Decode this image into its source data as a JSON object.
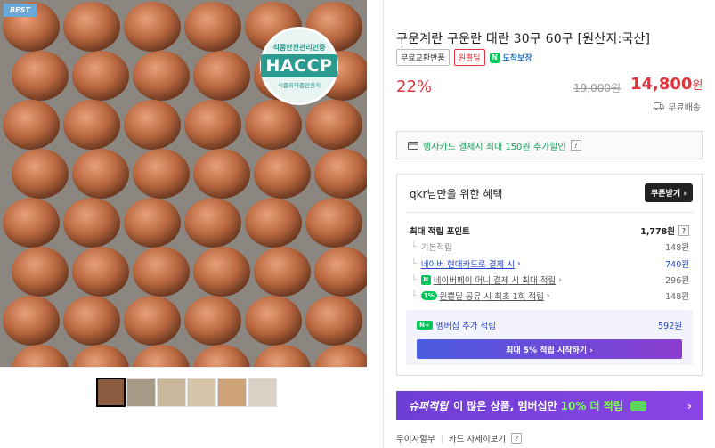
{
  "badge": "BEST",
  "haccp": {
    "top": "식품안전관리인증",
    "main": "HACCP",
    "bottom": "식품의약품안전처"
  },
  "product": {
    "title": "구운계란 구운란 대란 30구 60구 [원산지:국산]",
    "tags": [
      "무료교환반품",
      "원쁠딜"
    ],
    "delivery_tag": "도착보장",
    "discount": "22%",
    "original_price": "19,000원",
    "sale_price": "14,800",
    "sale_unit": "원",
    "shipping": "무료배송"
  },
  "card_promo": {
    "text": "행사카드 결제시 최대 150원 추가할인",
    "help": "?"
  },
  "benefit": {
    "heading": "qkr님만을 위한 혜택",
    "coupon_button": "쿠폰받기 ›",
    "max_points_label": "최대 적립 포인트",
    "max_points_value": "1,778원",
    "rows": [
      {
        "label": "기본적립",
        "value": "148원"
      },
      {
        "label": "네이버 현대카드로 결제 시",
        "value": "740원"
      },
      {
        "label": "네이버페이 머니 결제 시 최대 적립",
        "value": "296원"
      },
      {
        "label": "원쁠딜 공유 시 최초 1회 적립",
        "value": "148원"
      }
    ],
    "percent_badge": "1%",
    "member_label": "멤버십 추가 적립",
    "member_value": "592원",
    "member_button": "최대 5% 적립 시작하기 ›"
  },
  "banner": {
    "brand": "슈퍼적립",
    "text": "이 많은 상품, 멤버십만",
    "highlight": "10% 더 적립",
    "arrow": "›"
  },
  "bottom_links": [
    "무이자할부",
    "카드 자세히보기"
  ],
  "colors": {
    "accent_red": "#e0343f",
    "naver_green": "#03c75a",
    "membership_purple": "#6d3fd4"
  }
}
